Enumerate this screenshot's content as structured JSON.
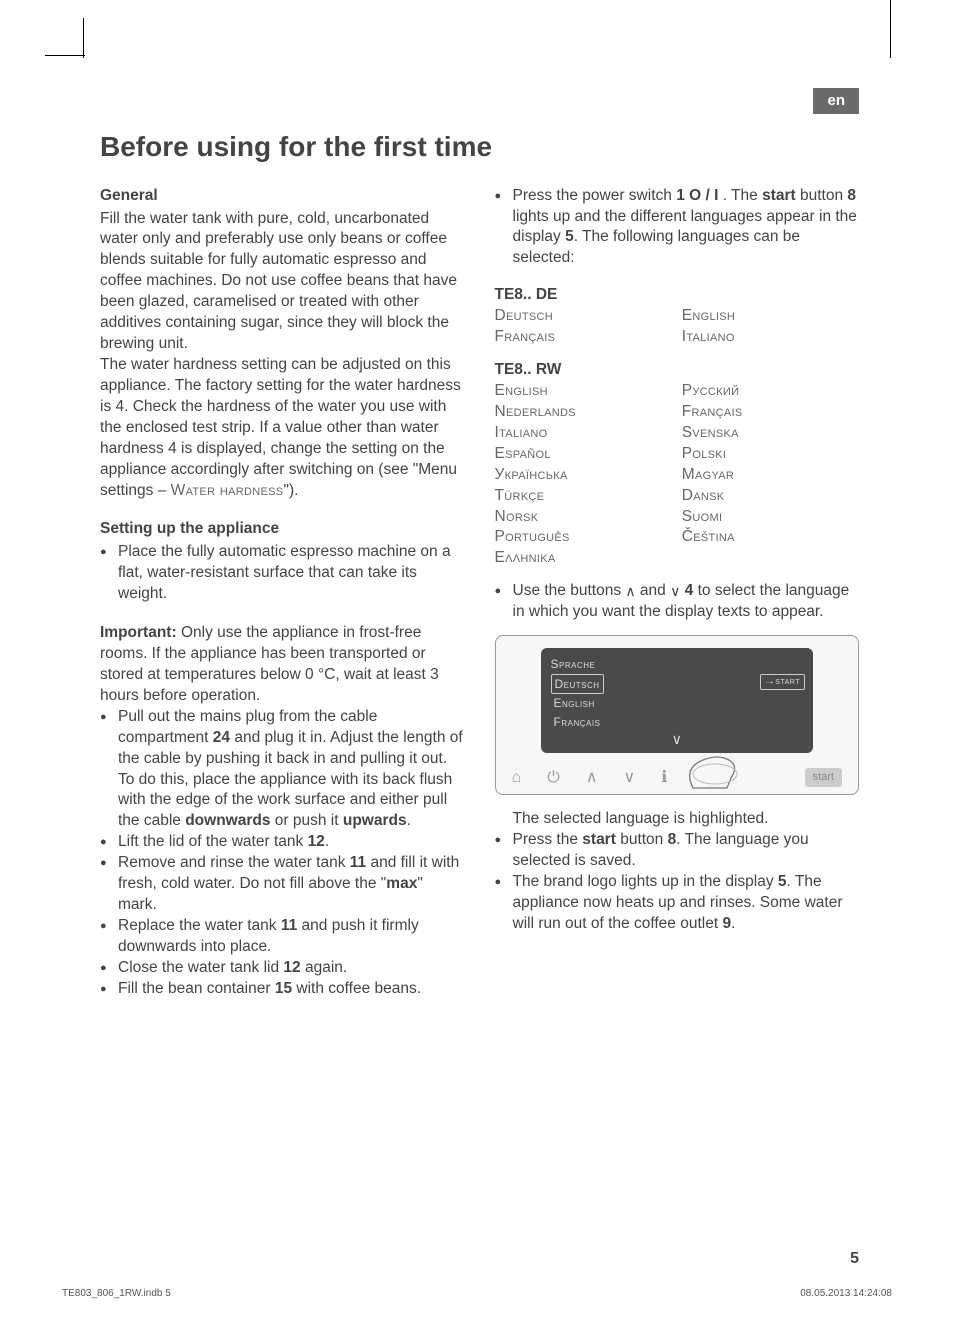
{
  "langTab": "en",
  "title": "Before using for the first time",
  "leftCol": {
    "generalHead": "General",
    "generalP1": "Fill the water tank with pure, cold, uncarbonated water only and preferably use only beans or coffee blends suitable for fully automatic espresso and coffee machines. Do not use coffee beans that have been glazed, caramelised or treated with other additives containing sugar, since they will block the brewing unit.",
    "generalP2a": "The water hardness setting can be adjusted on this appliance. The factory setting for the water hardness is 4. Check the hardness of the water you use with the enclosed test strip. If a value other than water hardness 4 is displayed, change the setting on the appliance accordingly after switching on (see \"Menu settings – ",
    "generalP2sc": "Water hardness",
    "generalP2b": "\").",
    "setupHead": "Setting up the appliance",
    "setupItem1": "Place the fully automatic espresso machine on a flat, water-resistant surface that can take its weight.",
    "importantLabel": "Important:",
    "importantText": " Only use the appliance in frost-free rooms. If the appliance has been transported or stored at temperatures below 0 °C, wait at least 3 hours before operation.",
    "li1a": "Pull out the mains plug from the cable compartment ",
    "li1n1": "24",
    "li1b": " and plug it in. Adjust the length of the cable by pushing it back in and pulling it out. To do this, place the appliance with its back flush with the edge of the work surface and either pull the cable ",
    "li1down": "downwards",
    "li1c": " or push it ",
    "li1up": "upwards",
    "li1d": ".",
    "li2a": "Lift the lid of the water tank ",
    "li2n": "12",
    "li2b": ".",
    "li3a": "Remove and rinse the water tank ",
    "li3n": "11",
    "li3b": " and fill it with fresh, cold water. Do not fill above the \"",
    "li3max": "max",
    "li3c": "\" mark.",
    "li4a": "Replace the water tank ",
    "li4n": "11",
    "li4b": " and push it firmly downwards into place.",
    "li5a": "Close the water tank lid ",
    "li5n": "12",
    "li5b": " again.",
    "li6a": "Fill the bean container ",
    "li6n": "15",
    "li6b": " with coffee beans."
  },
  "rightCol": {
    "powerA": "Press the power switch ",
    "powerN1": "1 O / I",
    "powerB": " . The ",
    "powerStart": "start",
    "powerC": " button ",
    "powerN2": "8",
    "powerD": " lights up and the different languages appear in the display ",
    "powerN3": "5",
    "powerE": ". The following languages can be selected:",
    "modelDE": "TE8.. DE",
    "deLangs": [
      "Deutsch",
      "English",
      "Français",
      "Italiano"
    ],
    "modelRW": "TE8.. RW",
    "rwLangs": [
      "English",
      "Русский",
      "Nederlands",
      "Français",
      "Italiano",
      "Svenska",
      "Español",
      "Polski",
      "Українська",
      "Magyar",
      "Türkçe",
      "Dansk",
      "Norsk",
      "Suomi",
      "Português",
      "Čeština",
      "Еλληνικα",
      ""
    ],
    "selLangA": "Use the buttons ",
    "selLangB": " and ",
    "selLangN": "4",
    "selLangC": " to select the language in which you want the display texts to appear.",
    "screen": {
      "title": "Sprache",
      "opt1": "Deutsch",
      "opt2": "English",
      "opt3": "Français",
      "startLabel": "start"
    },
    "afterScreen1": "The selected language is highlighted.",
    "press1a": "Press the ",
    "press1start": "start",
    "press1b": " button ",
    "press1n": "8",
    "press1c": ". The language you selected is saved.",
    "brand1a": "The brand logo lights up in the display ",
    "brand1n": "5",
    "brand1b": ". The appliance now heats up and rinses. Some water will run out of the coffee outlet ",
    "brand1n2": "9",
    "brand1c": "."
  },
  "pageNum": "5",
  "footerLeft": "TE803_806_1RW.indb   5",
  "footerRight": "08.05.2013   14:24:08"
}
